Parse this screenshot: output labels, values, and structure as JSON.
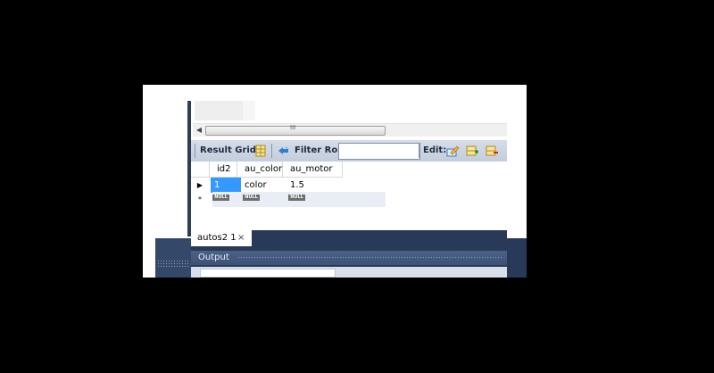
{
  "scrollbar": {
    "grip": "III"
  },
  "toolbar": {
    "result_grid_label": "Result Grid",
    "filter_rows_label": "Filter Rows:",
    "filter_value": "",
    "edit_label": "Edit:"
  },
  "grid": {
    "columns": [
      "id2",
      "au_color",
      "au_motor"
    ],
    "rows": [
      {
        "indicator": "▶",
        "values": [
          "1",
          "color",
          "1.5"
        ]
      }
    ],
    "new_row": {
      "indicator": "*",
      "values": [
        "NULL",
        "NULL",
        "NULL"
      ]
    }
  },
  "tabs": [
    {
      "label": "autos2 1",
      "close": "×"
    }
  ],
  "output": {
    "label": "Output"
  },
  "colors": {
    "accent_selection": "#3399ff",
    "dark_panel": "#283a57"
  }
}
